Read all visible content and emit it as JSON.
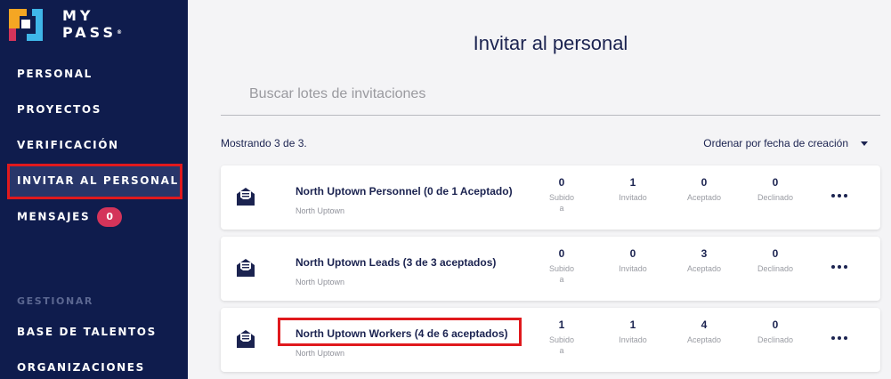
{
  "brand": {
    "line1": "MY",
    "line2": "PASS",
    "reg": "®"
  },
  "sidebar": {
    "items": [
      {
        "label": "PERSONAL"
      },
      {
        "label": "PROYECTOS"
      },
      {
        "label": "VERIFICACIÓN"
      },
      {
        "label": "INVITAR AL PERSONAL"
      },
      {
        "label": "MENSAJES",
        "badge": "0"
      }
    ],
    "section_label": "GESTIONAR",
    "manage_items": [
      {
        "label": "BASE DE TALENTOS"
      },
      {
        "label": "ORGANIZACIONES"
      }
    ]
  },
  "main": {
    "title": "Invitar al personal",
    "search_placeholder": "Buscar lotes de invitaciones",
    "showing": "Mostrando 3 de 3.",
    "sort_label": "Ordenar por fecha de creación"
  },
  "stat_labels": {
    "uploaded": "Subido a",
    "invited": "Invitado",
    "accepted": "Aceptado",
    "declined": "Declinado"
  },
  "batches": [
    {
      "name": "North Uptown Personnel (0 de 1 Aceptado)",
      "org": "North Uptown",
      "uploaded": "0",
      "invited": "1",
      "accepted": "0",
      "declined": "0"
    },
    {
      "name": "North Uptown Leads (3 de 3 aceptados)",
      "org": "North Uptown",
      "uploaded": "0",
      "invited": "0",
      "accepted": "3",
      "declined": "0"
    },
    {
      "name": "North Uptown Workers (4 de 6 aceptados)",
      "org": "North Uptown",
      "uploaded": "1",
      "invited": "1",
      "accepted": "4",
      "declined": "0"
    }
  ],
  "colors": {
    "sidebar_bg": "#0f1c4d",
    "accent_red": "#e0191d",
    "badge": "#d4345a",
    "text_dark": "#1b2350"
  }
}
